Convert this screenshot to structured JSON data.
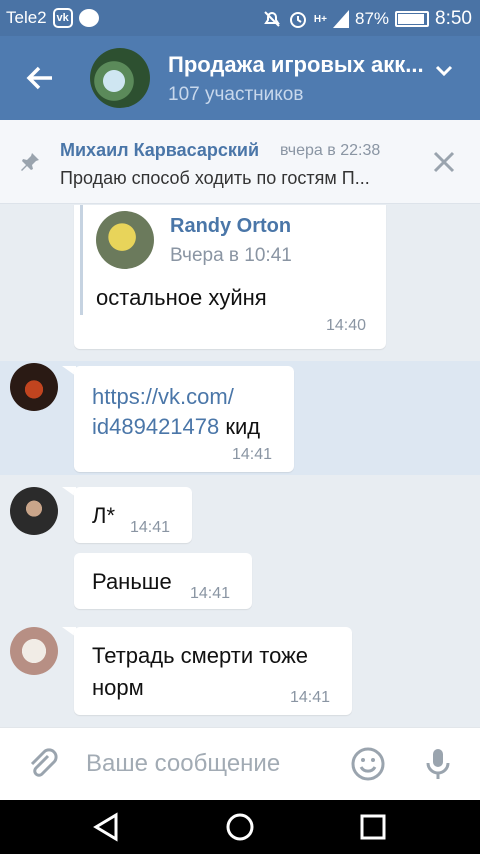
{
  "status": {
    "carrier": "Tele2",
    "network": "H+",
    "battery": "87%",
    "battery_level": 0.87,
    "time": "8:50"
  },
  "header": {
    "title": "Продажа игровых акк...",
    "subtitle": "107 участников"
  },
  "pinned": {
    "author": "Михаил Карвасарский",
    "date": "вчера в 22:38",
    "text": "Продаю способ ходить по гостям П..."
  },
  "messages": {
    "forward": {
      "author": "Randy Orton",
      "date": "Вчера в 10:41",
      "text": "остальное хуйня",
      "time": "14:40"
    },
    "m1": {
      "link": "https://vk.com/",
      "link2": "id489421478",
      "text": " кид",
      "time": "14:41"
    },
    "m2": {
      "text": "Л*",
      "time": "14:41"
    },
    "m3": {
      "text": "Раньше",
      "time": "14:41"
    },
    "m4": {
      "line1": "Тетрадь смерти тоже",
      "line2": "норм",
      "time": "14:41"
    }
  },
  "composer": {
    "placeholder": "Ваше сообщение"
  },
  "colors": {
    "header": "#4f7bb0",
    "statusbar": "#4a73a5",
    "link": "#4a76a8",
    "highlight": "#dde7f2"
  }
}
